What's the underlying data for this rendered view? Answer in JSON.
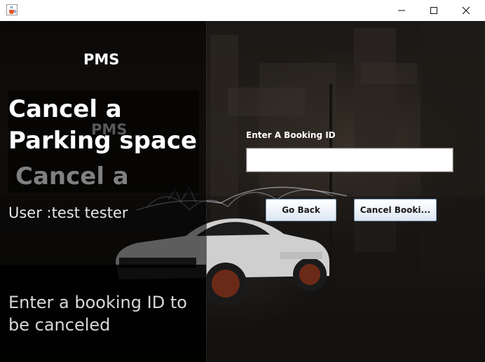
{
  "window": {
    "title": "",
    "minimize_icon": "minimize-icon",
    "maximize_icon": "maximize-icon",
    "close_icon": "close-icon",
    "app_icon": "java-cup-icon"
  },
  "left": {
    "app_name": "PMS",
    "heading": "Cancel a Parking space",
    "ghost_app_name": "PMS",
    "ghost_heading": "Cancel a",
    "user_label": "User :test tester",
    "description": "Enter a booking ID to be canceled"
  },
  "form": {
    "booking_label": "Enter A Booking ID",
    "booking_value": "",
    "go_back_label": "Go Back",
    "cancel_label": "Cancel Booki..."
  }
}
